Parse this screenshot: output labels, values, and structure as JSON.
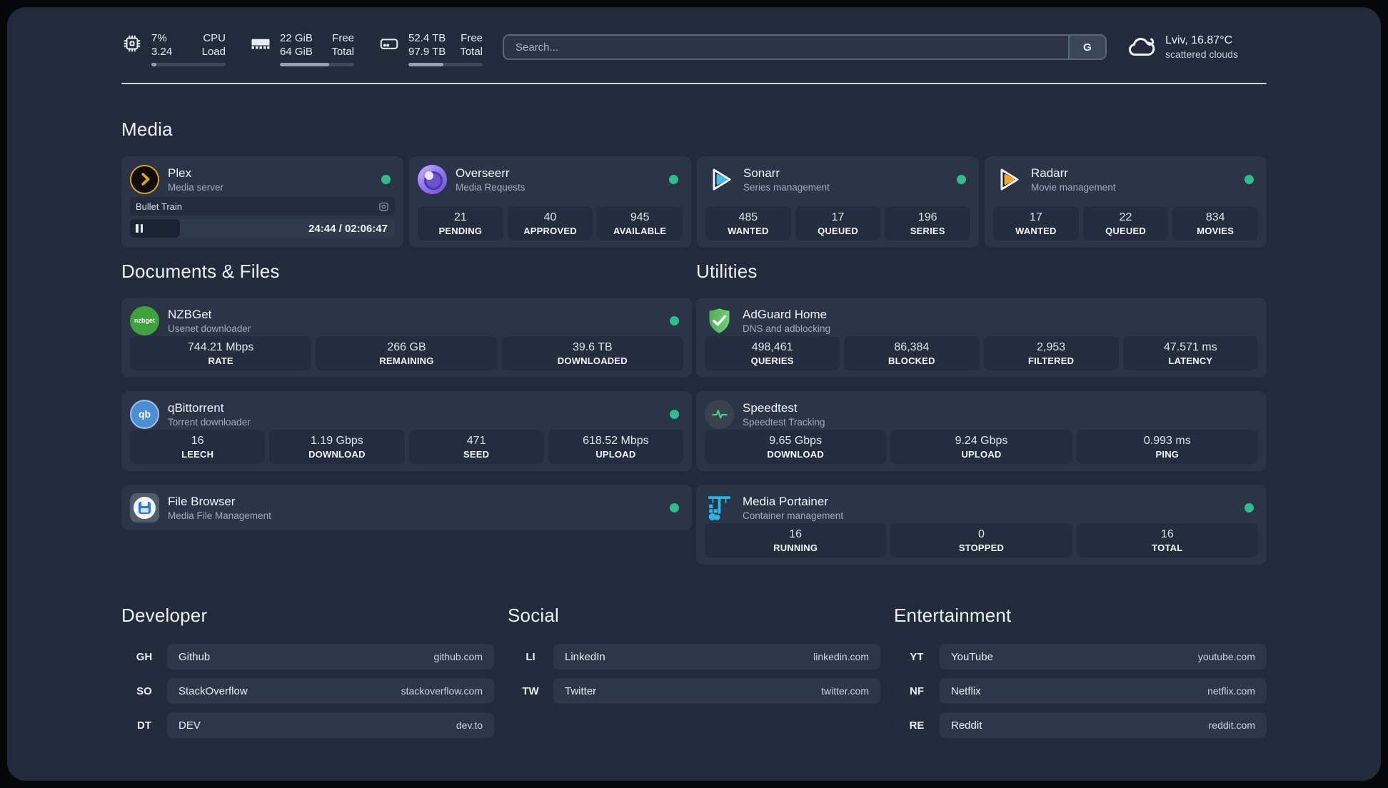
{
  "colors": {
    "panel_bg": "#212b3b",
    "card_bg": "#2b3547",
    "tile_bg": "#232d3e",
    "status_online": "#2bc186",
    "plex_amber": "#e5a00d",
    "sonarr_blue": "#38bff0",
    "radarr_amber": "#f5a623",
    "adguard_green": "#5cb85c",
    "portainer_blue": "#29b6e8",
    "speedtest_green": "#3ddc84",
    "qbittorrent_blue": "#4a8fd4",
    "nzbget_green": "#3fa23f"
  },
  "topbar": {
    "stats": [
      {
        "id": "cpu",
        "icon": "cpu-icon",
        "col1": [
          "7%",
          "3.24"
        ],
        "col2": [
          "CPU",
          "Load"
        ],
        "progress": 7
      },
      {
        "id": "memory",
        "icon": "memory-icon",
        "col1": [
          "22 GiB",
          "64 GiB"
        ],
        "col2": [
          "Free",
          "Total"
        ],
        "progress": 66
      },
      {
        "id": "disk",
        "icon": "disk-icon",
        "col1": [
          "52.4 TB",
          "97.9 TB"
        ],
        "col2": [
          "Free",
          "Total"
        ],
        "progress": 47
      }
    ],
    "search": {
      "placeholder": "Search...",
      "button": "G"
    },
    "weather": {
      "location_temp": "Lviv, 16.87°C",
      "condition": "scattered clouds",
      "icon": "cloud-icon"
    }
  },
  "sections": {
    "media": {
      "title": "Media",
      "apps": [
        {
          "name": "Plex",
          "subtitle": "Media server",
          "icon": "plex-icon",
          "online": true,
          "player": {
            "title": "Bullet Train",
            "time": "24:44 / 02:06:47",
            "elapsed_pct": 19
          }
        },
        {
          "name": "Overseerr",
          "subtitle": "Media Requests",
          "icon": "overseerr-icon",
          "online": true,
          "stats": [
            {
              "value": "21",
              "label": "PENDING"
            },
            {
              "value": "40",
              "label": "APPROVED"
            },
            {
              "value": "945",
              "label": "AVAILABLE"
            }
          ]
        },
        {
          "name": "Sonarr",
          "subtitle": "Series management",
          "icon": "sonarr-icon",
          "online": true,
          "stats": [
            {
              "value": "485",
              "label": "WANTED"
            },
            {
              "value": "17",
              "label": "QUEUED"
            },
            {
              "value": "196",
              "label": "SERIES"
            }
          ]
        },
        {
          "name": "Radarr",
          "subtitle": "Movie management",
          "icon": "radarr-icon",
          "online": true,
          "stats": [
            {
              "value": "17",
              "label": "WANTED"
            },
            {
              "value": "22",
              "label": "QUEUED"
            },
            {
              "value": "834",
              "label": "MOVIES"
            }
          ]
        }
      ]
    },
    "documents": {
      "title": "Documents & Files",
      "apps": [
        {
          "name": "NZBGet",
          "subtitle": "Usenet downloader",
          "icon": "nzbget-icon",
          "online": true,
          "stats": [
            {
              "value": "744.21 Mbps",
              "label": "RATE"
            },
            {
              "value": "266 GB",
              "label": "REMAINING"
            },
            {
              "value": "39.6 TB",
              "label": "DOWNLOADED"
            }
          ]
        },
        {
          "name": "qBittorrent",
          "subtitle": "Torrent downloader",
          "icon": "qbittorrent-icon",
          "online": true,
          "stats": [
            {
              "value": "16",
              "label": "LEECH"
            },
            {
              "value": "1.19 Gbps",
              "label": "DOWNLOAD"
            },
            {
              "value": "471",
              "label": "SEED"
            },
            {
              "value": "618.52 Mbps",
              "label": "UPLOAD"
            }
          ]
        },
        {
          "name": "File Browser",
          "subtitle": "Media File Management",
          "icon": "filebrowser-icon",
          "online": true
        }
      ]
    },
    "utilities": {
      "title": "Utilities",
      "apps": [
        {
          "name": "AdGuard Home",
          "subtitle": "DNS and adblocking",
          "icon": "adguard-icon",
          "online": false,
          "stats": [
            {
              "value": "498,461",
              "label": "QUERIES"
            },
            {
              "value": "86,384",
              "label": "BLOCKED"
            },
            {
              "value": "2,953",
              "label": "FILTERED"
            },
            {
              "value": "47.571 ms",
              "label": "LATENCY"
            }
          ]
        },
        {
          "name": "Speedtest",
          "subtitle": "Speedtest Tracking",
          "icon": "speedtest-icon",
          "online": false,
          "stats": [
            {
              "value": "9.65 Gbps",
              "label": "DOWNLOAD"
            },
            {
              "value": "9.24 Gbps",
              "label": "UPLOAD"
            },
            {
              "value": "0.993 ms",
              "label": "PING"
            }
          ]
        },
        {
          "name": "Media Portainer",
          "subtitle": "Container management",
          "icon": "portainer-icon",
          "online": true,
          "stats": [
            {
              "value": "16",
              "label": "RUNNING"
            },
            {
              "value": "0",
              "label": "STOPPED"
            },
            {
              "value": "16",
              "label": "TOTAL"
            }
          ]
        }
      ]
    },
    "bookmarks": [
      {
        "title": "Developer",
        "links": [
          {
            "abbr": "GH",
            "name": "Github",
            "url": "github.com"
          },
          {
            "abbr": "SO",
            "name": "StackOverflow",
            "url": "stackoverflow.com"
          },
          {
            "abbr": "DT",
            "name": "DEV",
            "url": "dev.to"
          }
        ]
      },
      {
        "title": "Social",
        "links": [
          {
            "abbr": "LI",
            "name": "LinkedIn",
            "url": "linkedin.com"
          },
          {
            "abbr": "TW",
            "name": "Twitter",
            "url": "twitter.com"
          }
        ]
      },
      {
        "title": "Entertainment",
        "links": [
          {
            "abbr": "YT",
            "name": "YouTube",
            "url": "youtube.com"
          },
          {
            "abbr": "NF",
            "name": "Netflix",
            "url": "netflix.com"
          },
          {
            "abbr": "RE",
            "name": "Reddit",
            "url": "reddit.com"
          }
        ]
      }
    ]
  }
}
